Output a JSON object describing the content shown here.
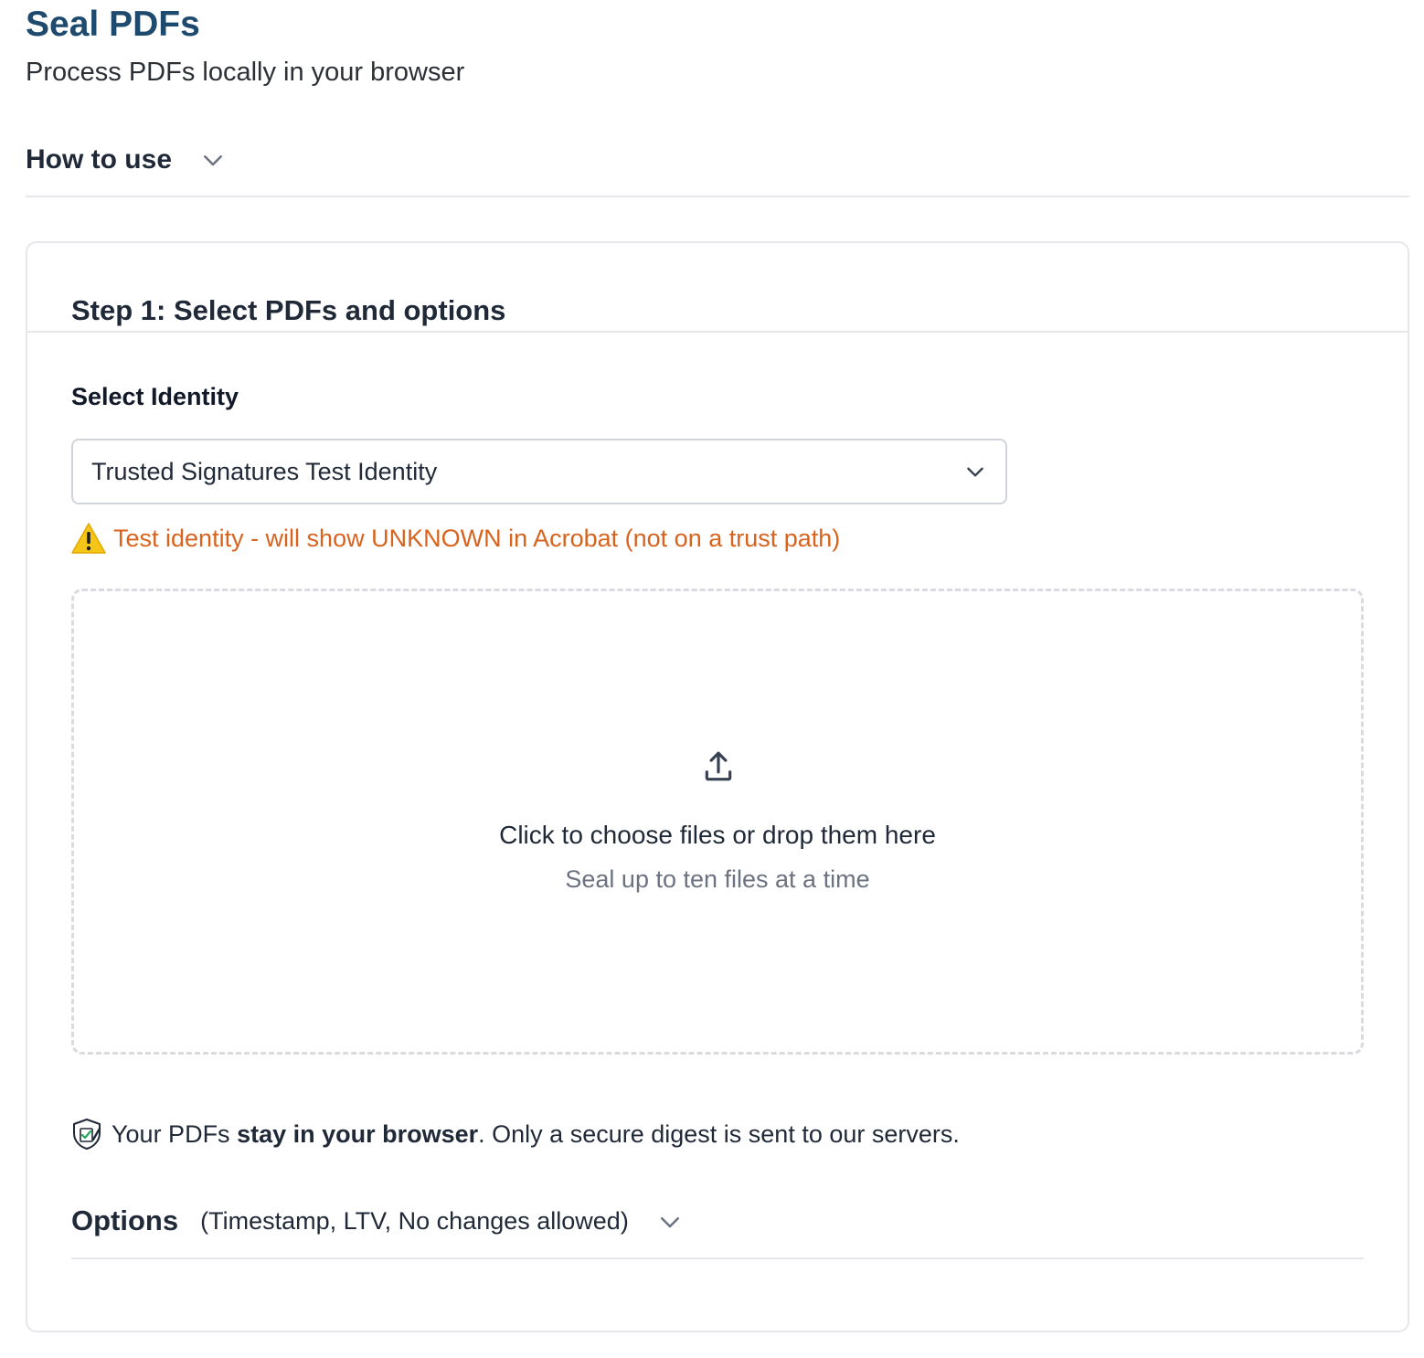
{
  "header": {
    "title": "Seal PDFs",
    "subtitle": "Process PDFs locally in your browser"
  },
  "how_to_use": {
    "label": "How to use",
    "icon": "chevron-down-icon"
  },
  "step1": {
    "title": "Step 1: Select PDFs and options",
    "identity_label": "Select Identity",
    "identity_selected": "Trusted Signatures Test Identity",
    "warning_text": "Test identity - will show UNKNOWN in Acrobat (not on a trust path)",
    "dropzone": {
      "main_text": "Click to choose files or drop them here",
      "sub_text": "Seal up to ten files at a time",
      "icon": "upload-icon"
    },
    "privacy": {
      "prefix": "Your PDFs ",
      "bold": "stay in your browser",
      "suffix": ". Only a secure digest is sent to our servers.",
      "icon": "shield-icon"
    },
    "options": {
      "label": "Options",
      "detail": "(Timestamp, LTV, No changes allowed)"
    }
  },
  "colors": {
    "title": "#1e4a6e",
    "warning": "#d9631c",
    "border": "#e5e7eb"
  }
}
